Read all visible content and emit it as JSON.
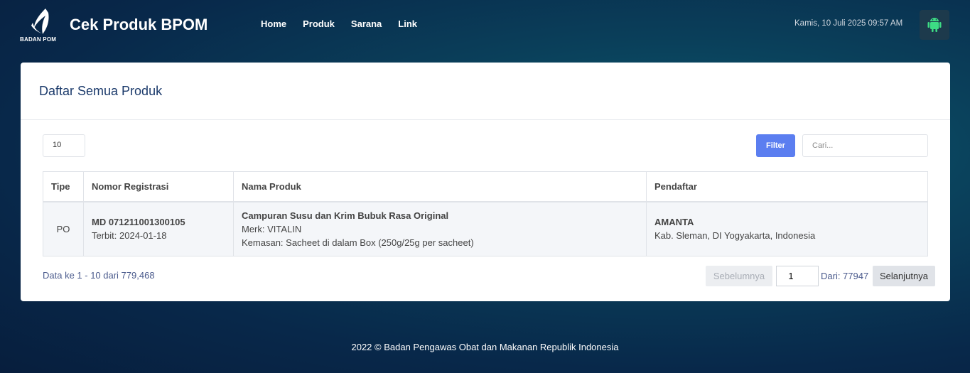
{
  "header": {
    "logo_text": "BADAN POM",
    "brand": "Cek Produk BPOM",
    "nav": [
      "Home",
      "Produk",
      "Sarana",
      "Link"
    ],
    "datetime": "Kamis, 10 Juli 2025 09:57 AM",
    "android_icon": "android-icon"
  },
  "card": {
    "title": "Daftar Semua Produk",
    "length_value": "10",
    "filter_label": "Filter",
    "search_placeholder": "Cari..."
  },
  "table": {
    "columns": [
      "Tipe",
      "Nomor Registrasi",
      "Nama Produk",
      "Pendaftar"
    ],
    "rows": [
      {
        "tipe": "PO",
        "nomor": "MD 071211001300105",
        "terbit": "Terbit: 2024-01-18",
        "nama": "Campuran Susu dan Krim Bubuk Rasa Original",
        "merk": "Merk: VITALIN",
        "kemasan": "Kemasan: Sacheet di dalam Box (250g/25g per sacheet)",
        "pendaftar": "AMANTA",
        "lokasi": "Kab. Sleman, DI Yogyakarta, Indonesia"
      }
    ]
  },
  "pagination": {
    "info": "Data ke 1 - 10 dari 779,468",
    "prev_label": "Sebelumnya",
    "page_value": "1",
    "of_text": "Dari: 77947",
    "next_label": "Selanjutnya"
  },
  "footer": "2022 ©  Badan Pengawas Obat dan Makanan Republik Indonesia",
  "colors": {
    "accent": "#5b7ef0",
    "title": "#1b3a6b",
    "android": "#3ddc84"
  }
}
